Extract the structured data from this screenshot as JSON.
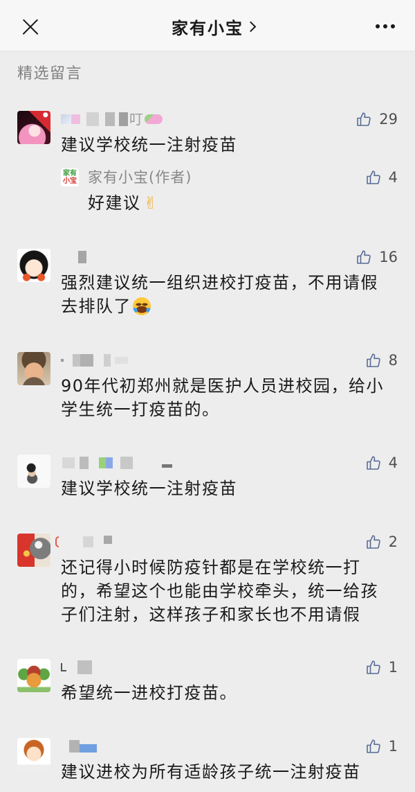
{
  "nav": {
    "close_icon": "close-icon",
    "title": "家有小宝",
    "chevron_icon": "chevron-right-icon",
    "more_icon": "more-dots-icon"
  },
  "section_title": "精选留言",
  "colors": {
    "page_background": "#ededed",
    "nav_background": "#f7f7f7",
    "text": "#191919",
    "secondary_text": "#888888",
    "like_icon": "#576b95"
  },
  "like_icon": "thumbs-up-icon",
  "comments": [
    {
      "name_visible": "叮",
      "likes": "29",
      "lines": [
        "建议学校统一注射疫苗"
      ],
      "reply": {
        "avatar_logo": [
          "家有",
          "小宝"
        ],
        "name": "家有小宝(作者)",
        "likes": "4",
        "text": "好建议",
        "emoji": "✌"
      }
    },
    {
      "likes": "16",
      "lines": [
        "强烈建议统一组织进校打疫苗，不用请假",
        "去排队了"
      ],
      "emoji_icon": "face-with-tears-of-joy-emoji"
    },
    {
      "likes": "8",
      "lines": [
        "90年代初郑州就是医护人员进校园，给小",
        "学生统一打疫苗的。"
      ]
    },
    {
      "likes": "4",
      "lines": [
        "建议学校统一注射疫苗"
      ]
    },
    {
      "likes": "2",
      "lines": [
        "还记得小时候防疫针都是在学校统一打",
        "的，希望这个也能由学校牵头，统一给孩",
        "子们注射，这样孩子和家长也不用请假"
      ]
    },
    {
      "likes": "1",
      "lines": [
        "希望统一进校打疫苗。"
      ]
    },
    {
      "likes": "1",
      "lines": [
        "建议进校为所有适龄孩子统一注射疫苗"
      ]
    }
  ]
}
